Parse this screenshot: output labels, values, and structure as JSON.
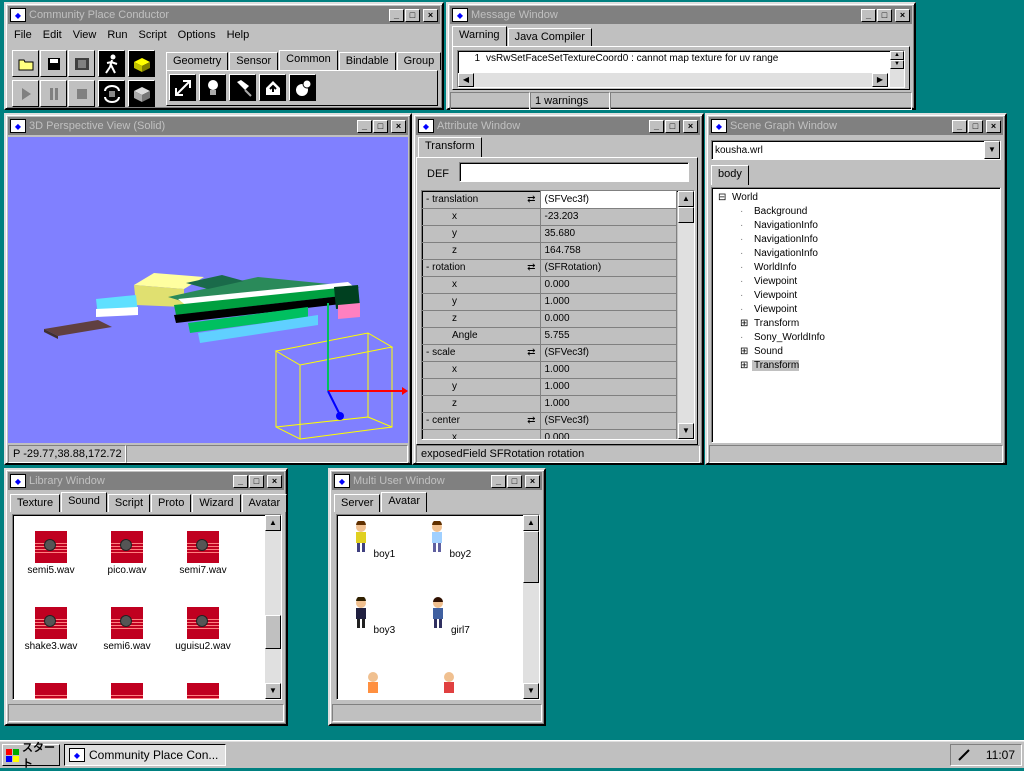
{
  "conductor": {
    "title": "Community Place Conductor",
    "menu": [
      "File",
      "Edit",
      "View",
      "Run",
      "Script",
      "Options",
      "Help"
    ],
    "tabs": [
      "Geometry",
      "Sensor",
      "Common",
      "Bindable",
      "Group"
    ],
    "active_tab": "Common"
  },
  "message": {
    "title": "Message Window",
    "tabs": [
      "Warning",
      "Java Compiler"
    ],
    "line_no": "1",
    "text": "vsRwSetFaceSetTextureCoord0 : cannot map texture for uv range",
    "status": "1 warnings"
  },
  "view3d": {
    "title": "3D Perspective View (Solid)",
    "status": "P -29.77,38.88,172.72"
  },
  "attr": {
    "title": "Attribute Window",
    "tab": "Transform",
    "def_label": "DEF",
    "def_value": "",
    "rows": [
      {
        "name": "- translation",
        "value": "(SFVec3f)",
        "field": true
      },
      {
        "name": "x",
        "value": "-23.203"
      },
      {
        "name": "y",
        "value": "35.680"
      },
      {
        "name": "z",
        "value": "164.758"
      },
      {
        "name": "- rotation",
        "value": "(SFRotation)",
        "field": true
      },
      {
        "name": "x",
        "value": "0.000"
      },
      {
        "name": "y",
        "value": "1.000"
      },
      {
        "name": "z",
        "value": "0.000"
      },
      {
        "name": "Angle",
        "value": "5.755"
      },
      {
        "name": "- scale",
        "value": "(SFVec3f)",
        "field": true
      },
      {
        "name": "x",
        "value": "1.000"
      },
      {
        "name": "y",
        "value": "1.000"
      },
      {
        "name": "z",
        "value": "1.000"
      },
      {
        "name": "- center",
        "value": "(SFVec3f)",
        "field": true
      },
      {
        "name": "x",
        "value": "0.000"
      }
    ],
    "status": "exposedField SFRotation rotation"
  },
  "scene": {
    "title": "Scene Graph Window",
    "file": "kousha.wrl",
    "tab": "body",
    "nodes": [
      {
        "label": "World",
        "exp": "minus"
      },
      {
        "label": "Background",
        "exp": ""
      },
      {
        "label": "NavigationInfo",
        "exp": ""
      },
      {
        "label": "NavigationInfo",
        "exp": ""
      },
      {
        "label": "NavigationInfo",
        "exp": ""
      },
      {
        "label": "WorldInfo",
        "exp": ""
      },
      {
        "label": "Viewpoint",
        "exp": ""
      },
      {
        "label": "Viewpoint",
        "exp": ""
      },
      {
        "label": "Viewpoint",
        "exp": ""
      },
      {
        "label": "Transform",
        "exp": "plus"
      },
      {
        "label": "Sony_WorldInfo",
        "exp": ""
      },
      {
        "label": "Sound",
        "exp": "plus"
      },
      {
        "label": "Transform",
        "exp": "plus",
        "selected": true
      }
    ]
  },
  "library": {
    "title": "Library Window",
    "tabs": [
      "Texture",
      "Sound",
      "Script",
      "Proto",
      "Wizard",
      "Avatar"
    ],
    "active_tab": "Sound",
    "items": [
      "semi5.wav",
      "pico.wav",
      "semi7.wav",
      "shake3.wav",
      "semi6.wav",
      "uguisu2.wav"
    ]
  },
  "multiuser": {
    "title": "Multi User Window",
    "tabs": [
      "Server",
      "Avatar"
    ],
    "active_tab": "Avatar",
    "avatars": [
      "boy1",
      "boy2",
      "boy3",
      "girl7"
    ]
  },
  "taskbar": {
    "start": "スタート",
    "task": "Community Place Con...",
    "clock": "11:07"
  }
}
